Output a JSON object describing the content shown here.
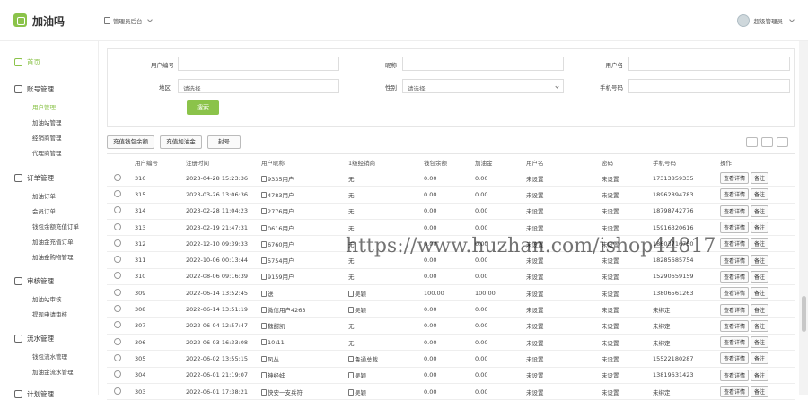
{
  "app": {
    "title": "加油吗",
    "role": "管理员后台",
    "user": "超级管理员"
  },
  "sidebar": {
    "home": "首页",
    "groups": [
      {
        "label": "账号管理",
        "items": [
          "用户管理",
          "加油站管理",
          "经销商管理",
          "代理商管理"
        ]
      },
      {
        "label": "订单管理",
        "items": [
          "加油订单",
          "会员订单",
          "钱包余额充值订单",
          "加油金充值订单",
          "加油金购物管理"
        ]
      },
      {
        "label": "审核管理",
        "items": [
          "加油站审核",
          "提现申请审核"
        ]
      },
      {
        "label": "流水管理",
        "items": [
          "钱包流水管理",
          "加油金流水管理"
        ]
      },
      {
        "label": "计划管理",
        "items": []
      }
    ]
  },
  "filter": {
    "user_id_label": "用户编号",
    "nickname_label": "昵称",
    "username_label": "用户名",
    "region_label": "地区",
    "region_placeholder": "请选择",
    "gender_label": "性别",
    "gender_placeholder": "请选择",
    "phone_label": "手机号码",
    "search_label": "搜索"
  },
  "toolbar": {
    "recharge_wallet": "充值钱包余额",
    "recharge_fuel": "充值加油金",
    "ban": "封号"
  },
  "table": {
    "headers": [
      "用户编号",
      "注册时间",
      "用户昵称",
      "1级经销商",
      "钱包余额",
      "加油金",
      "用户名",
      "密码",
      "手机号码",
      "操作"
    ],
    "detail_label": "查看详情",
    "note_label": "备注",
    "rows": [
      [
        "316",
        "2023-04-28 15:23:36",
        "9335用户",
        "无",
        "0.00",
        "0.00",
        "未设置",
        "未设置",
        "17313859335"
      ],
      [
        "315",
        "2023-03-26 13:06:36",
        "4783用户",
        "无",
        "0.00",
        "0.00",
        "未设置",
        "未设置",
        "18962894783"
      ],
      [
        "314",
        "2023-02-28 11:04:23",
        "2776用户",
        "无",
        "0.00",
        "0.00",
        "未设置",
        "未设置",
        "18798742776"
      ],
      [
        "313",
        "2023-02-19 21:47:31",
        "0616用户",
        "无",
        "0.00",
        "0.00",
        "未设置",
        "未设置",
        "15916320616"
      ],
      [
        "312",
        "2022-12-10 09:39:33",
        "6760用户",
        "无",
        "0.00",
        "0.00",
        "未设置",
        "未设置",
        "18603716760"
      ],
      [
        "311",
        "2022-10-06 00:13:44",
        "5754用户",
        "无",
        "0.00",
        "0.00",
        "未设置",
        "未设置",
        "18285685754"
      ],
      [
        "310",
        "2022-08-06 09:16:39",
        "9159用户",
        "无",
        "0.00",
        "0.00",
        "未设置",
        "未设置",
        "15290659159"
      ],
      [
        "309",
        "2022-06-14 13:52:45",
        "送",
        "吴颖",
        "100.00",
        "100.00",
        "未设置",
        "未设置",
        "13806561263"
      ],
      [
        "308",
        "2022-06-14 13:51:19",
        "微信用户4263",
        "吴颖",
        "0.00",
        "0.00",
        "未设置",
        "未设置",
        "未绑定"
      ],
      [
        "307",
        "2022-06-04 12:57:47",
        "魏甜凯",
        "无",
        "0.00",
        "0.00",
        "未设置",
        "未设置",
        "未绑定"
      ],
      [
        "306",
        "2022-06-03 16:33:08",
        "10:11",
        "无",
        "0.00",
        "0.00",
        "未设置",
        "未设置",
        "未绑定"
      ],
      [
        "305",
        "2022-06-02 13:55:15",
        "风丛",
        "鲁通总裁",
        "0.00",
        "0.00",
        "未设置",
        "未设置",
        "15522180287"
      ],
      [
        "304",
        "2022-06-01 21:19:07",
        "神经蛙",
        "吴颖",
        "0.00",
        "0.00",
        "未设置",
        "未设置",
        "13819631423"
      ],
      [
        "303",
        "2022-06-01 17:38:21",
        "快安一支兵符",
        "吴颖",
        "0.00",
        "0.00",
        "未设置",
        "未设置",
        "未绑定"
      ]
    ]
  },
  "watermark": "https://www.huzhan.com/ishop44817",
  "colors": {
    "accent": "#8bc34a"
  }
}
